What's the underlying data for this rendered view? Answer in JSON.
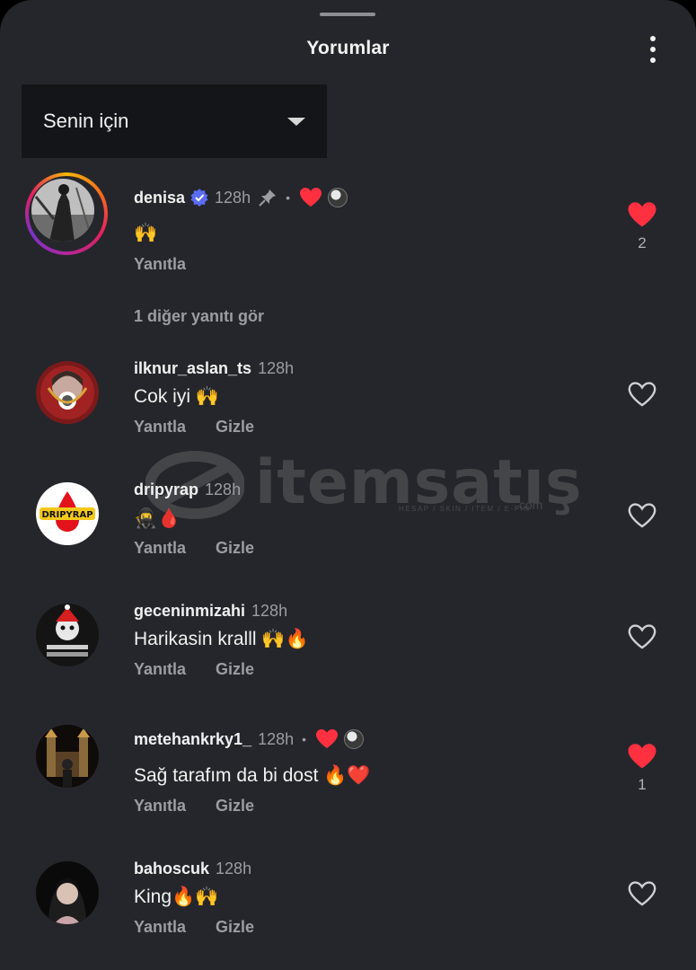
{
  "header": {
    "title": "Yorumlar",
    "more_icon": "more-vertical-icon"
  },
  "sort": {
    "selected": "Senin için"
  },
  "watermark": {
    "brand": "itemsatış",
    "tagline": "HESAP / SKIN / ITEM / E-PIN",
    "suffix": ".com"
  },
  "comments": [
    {
      "username": "denisa",
      "verified": true,
      "time": "128h",
      "pinned": true,
      "creator_liked": true,
      "text": "🙌",
      "reply_label": "Yanıtla",
      "hide_label": "",
      "liked": true,
      "like_count": "2",
      "more_replies": "1 diğer yanıtı gör"
    },
    {
      "username": "ilknur_aslan_ts",
      "time": "128h",
      "text": "Cok iyi 🙌",
      "reply_label": "Yanıtla",
      "hide_label": "Gizle",
      "liked": false,
      "like_count": ""
    },
    {
      "username": "dripyrap",
      "time": "128h",
      "text": "🥷🩸",
      "reply_label": "Yanıtla",
      "hide_label": "Gizle",
      "liked": false,
      "like_count": "",
      "avatar_text": "DRIPYRAP"
    },
    {
      "username": "geceninmizahi",
      "time": "128h",
      "text": "Harikasin kralll 🙌🔥",
      "reply_label": "Yanıtla",
      "hide_label": "Gizle",
      "liked": false,
      "like_count": ""
    },
    {
      "username": "metehankrky1_",
      "time": "128h",
      "creator_liked": true,
      "text": "Sağ tarafım da bi dost 🔥❤️",
      "reply_label": "Yanıtla",
      "hide_label": "Gizle",
      "liked": true,
      "like_count": "1"
    },
    {
      "username": "bahoscuk",
      "time": "128h",
      "text": "King🔥🙌",
      "reply_label": "Yanıtla",
      "hide_label": "Gizle",
      "liked": false,
      "like_count": ""
    }
  ],
  "colors": {
    "background": "#25262b",
    "like_red": "#ff3040",
    "muted_text": "#9c9da2",
    "verified_blue": "#5b6cf5"
  }
}
